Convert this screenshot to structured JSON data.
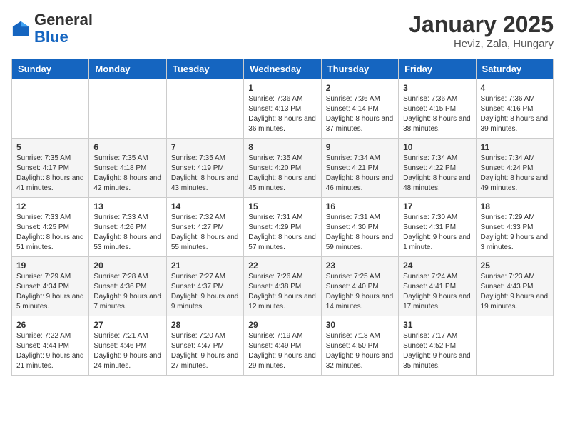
{
  "header": {
    "logo_general": "General",
    "logo_blue": "Blue",
    "title": "January 2025",
    "subtitle": "Heviz, Zala, Hungary"
  },
  "weekdays": [
    "Sunday",
    "Monday",
    "Tuesday",
    "Wednesday",
    "Thursday",
    "Friday",
    "Saturday"
  ],
  "weeks": [
    [
      {
        "day": "",
        "info": ""
      },
      {
        "day": "",
        "info": ""
      },
      {
        "day": "",
        "info": ""
      },
      {
        "day": "1",
        "info": "Sunrise: 7:36 AM\nSunset: 4:13 PM\nDaylight: 8 hours and 36 minutes."
      },
      {
        "day": "2",
        "info": "Sunrise: 7:36 AM\nSunset: 4:14 PM\nDaylight: 8 hours and 37 minutes."
      },
      {
        "day": "3",
        "info": "Sunrise: 7:36 AM\nSunset: 4:15 PM\nDaylight: 8 hours and 38 minutes."
      },
      {
        "day": "4",
        "info": "Sunrise: 7:36 AM\nSunset: 4:16 PM\nDaylight: 8 hours and 39 minutes."
      }
    ],
    [
      {
        "day": "5",
        "info": "Sunrise: 7:35 AM\nSunset: 4:17 PM\nDaylight: 8 hours and 41 minutes."
      },
      {
        "day": "6",
        "info": "Sunrise: 7:35 AM\nSunset: 4:18 PM\nDaylight: 8 hours and 42 minutes."
      },
      {
        "day": "7",
        "info": "Sunrise: 7:35 AM\nSunset: 4:19 PM\nDaylight: 8 hours and 43 minutes."
      },
      {
        "day": "8",
        "info": "Sunrise: 7:35 AM\nSunset: 4:20 PM\nDaylight: 8 hours and 45 minutes."
      },
      {
        "day": "9",
        "info": "Sunrise: 7:34 AM\nSunset: 4:21 PM\nDaylight: 8 hours and 46 minutes."
      },
      {
        "day": "10",
        "info": "Sunrise: 7:34 AM\nSunset: 4:22 PM\nDaylight: 8 hours and 48 minutes."
      },
      {
        "day": "11",
        "info": "Sunrise: 7:34 AM\nSunset: 4:24 PM\nDaylight: 8 hours and 49 minutes."
      }
    ],
    [
      {
        "day": "12",
        "info": "Sunrise: 7:33 AM\nSunset: 4:25 PM\nDaylight: 8 hours and 51 minutes."
      },
      {
        "day": "13",
        "info": "Sunrise: 7:33 AM\nSunset: 4:26 PM\nDaylight: 8 hours and 53 minutes."
      },
      {
        "day": "14",
        "info": "Sunrise: 7:32 AM\nSunset: 4:27 PM\nDaylight: 8 hours and 55 minutes."
      },
      {
        "day": "15",
        "info": "Sunrise: 7:31 AM\nSunset: 4:29 PM\nDaylight: 8 hours and 57 minutes."
      },
      {
        "day": "16",
        "info": "Sunrise: 7:31 AM\nSunset: 4:30 PM\nDaylight: 8 hours and 59 minutes."
      },
      {
        "day": "17",
        "info": "Sunrise: 7:30 AM\nSunset: 4:31 PM\nDaylight: 9 hours and 1 minute."
      },
      {
        "day": "18",
        "info": "Sunrise: 7:29 AM\nSunset: 4:33 PM\nDaylight: 9 hours and 3 minutes."
      }
    ],
    [
      {
        "day": "19",
        "info": "Sunrise: 7:29 AM\nSunset: 4:34 PM\nDaylight: 9 hours and 5 minutes."
      },
      {
        "day": "20",
        "info": "Sunrise: 7:28 AM\nSunset: 4:36 PM\nDaylight: 9 hours and 7 minutes."
      },
      {
        "day": "21",
        "info": "Sunrise: 7:27 AM\nSunset: 4:37 PM\nDaylight: 9 hours and 9 minutes."
      },
      {
        "day": "22",
        "info": "Sunrise: 7:26 AM\nSunset: 4:38 PM\nDaylight: 9 hours and 12 minutes."
      },
      {
        "day": "23",
        "info": "Sunrise: 7:25 AM\nSunset: 4:40 PM\nDaylight: 9 hours and 14 minutes."
      },
      {
        "day": "24",
        "info": "Sunrise: 7:24 AM\nSunset: 4:41 PM\nDaylight: 9 hours and 17 minutes."
      },
      {
        "day": "25",
        "info": "Sunrise: 7:23 AM\nSunset: 4:43 PM\nDaylight: 9 hours and 19 minutes."
      }
    ],
    [
      {
        "day": "26",
        "info": "Sunrise: 7:22 AM\nSunset: 4:44 PM\nDaylight: 9 hours and 21 minutes."
      },
      {
        "day": "27",
        "info": "Sunrise: 7:21 AM\nSunset: 4:46 PM\nDaylight: 9 hours and 24 minutes."
      },
      {
        "day": "28",
        "info": "Sunrise: 7:20 AM\nSunset: 4:47 PM\nDaylight: 9 hours and 27 minutes."
      },
      {
        "day": "29",
        "info": "Sunrise: 7:19 AM\nSunset: 4:49 PM\nDaylight: 9 hours and 29 minutes."
      },
      {
        "day": "30",
        "info": "Sunrise: 7:18 AM\nSunset: 4:50 PM\nDaylight: 9 hours and 32 minutes."
      },
      {
        "day": "31",
        "info": "Sunrise: 7:17 AM\nSunset: 4:52 PM\nDaylight: 9 hours and 35 minutes."
      },
      {
        "day": "",
        "info": ""
      }
    ]
  ]
}
